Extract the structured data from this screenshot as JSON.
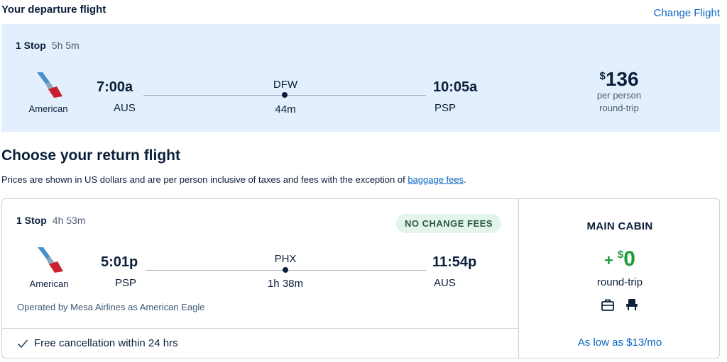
{
  "departure": {
    "heading": "Your departure flight",
    "change_label": "Change Flight",
    "stops": "1 Stop",
    "duration": "5h 5m",
    "airline": "American",
    "depart_time": "7:00a",
    "depart_code": "AUS",
    "via_code": "DFW",
    "layover": "44m",
    "arrive_time": "10:05a",
    "arrive_code": "PSP",
    "price_currency": "$",
    "price_amount": "136",
    "price_per": "per person",
    "price_trip": "round-trip"
  },
  "return": {
    "heading": "Choose your return flight",
    "disclaimer_text": "Prices are shown in US dollars and are per person inclusive of taxes and fees with the exception of ",
    "disclaimer_link": "baggage fees",
    "disclaimer_end": ".",
    "flight": {
      "stops": "1 Stop",
      "duration": "4h 53m",
      "badge": "NO CHANGE FEES",
      "airline": "American",
      "depart_time": "5:01p",
      "depart_code": "PSP",
      "via_code": "PHX",
      "layover": "1h 38m",
      "arrive_time": "11:54p",
      "arrive_code": "AUS",
      "operated_by": "Operated by Mesa Airlines as American Eagle",
      "free_cancel": "Free cancellation within 24 hrs"
    },
    "cabin": {
      "title": "MAIN CABIN",
      "plus": "+",
      "currency": "$",
      "amount": "0",
      "trip": "round-trip",
      "icons": [
        "carry-on-bag-icon",
        "seat-icon"
      ],
      "financing": "As low as $13/mo"
    }
  },
  "colors": {
    "accent": "#0a66c2",
    "departure_bg": "#e3effc",
    "price_green": "#1f9a3a",
    "badge_bg": "#e3f4ea"
  }
}
